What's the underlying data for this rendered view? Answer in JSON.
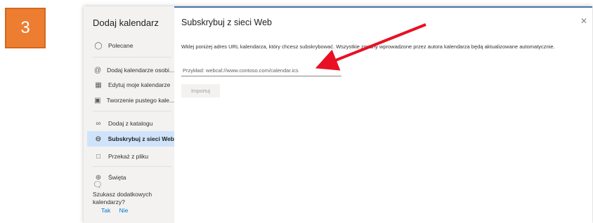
{
  "step": {
    "number": "3",
    "color": "#ed7d31"
  },
  "sidebar": {
    "title": "Dodaj kalendarz",
    "items": [
      {
        "label": "Polecane",
        "icon": "lightbulb-icon"
      },
      {
        "label": "Dodaj kalendarze osobi...",
        "icon": "at-sign-icon"
      },
      {
        "label": "Edytuj moje kalendarze",
        "icon": "calendar-edit-icon"
      },
      {
        "label": "Tworzenie pustego kale...",
        "icon": "calendar-blank-icon"
      },
      {
        "label": "Dodaj z katalogu",
        "icon": "people-icon"
      },
      {
        "label": "Subskrybuj z sieci Web",
        "icon": "globe-icon",
        "active": true
      },
      {
        "label": "Przekaż z pliku",
        "icon": "document-icon"
      },
      {
        "label": "Święta",
        "icon": "globe-icon"
      }
    ],
    "help": {
      "question": "Szukasz dodatkowych kalendarzy?",
      "yes": "Tak",
      "no": "Nie"
    }
  },
  "main": {
    "title": "Subskrybuj z sieci Web",
    "description": "Wklej poniżej adres URL kalendarza, który chcesz subskrybować. Wszystkie zmiany wprowadzone przez autora kalendarza będą aktualizowane automatycznie.",
    "url_placeholder": "Przykład: webcal://www.contoso.com/calendar.ics",
    "url_value": "",
    "import_label": "Importuj",
    "close_icon": "close-icon"
  },
  "colors": {
    "accent": "#0078d4",
    "active_bg": "#cfe4fa",
    "annotation_arrow": "#e81123"
  }
}
